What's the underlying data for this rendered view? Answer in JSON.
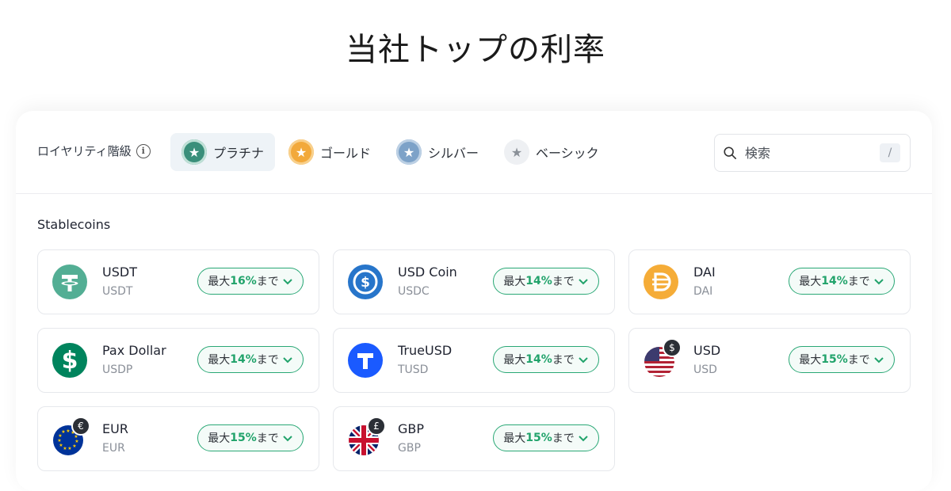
{
  "page": {
    "title": "当社トップの利率"
  },
  "filters": {
    "loyalty_label": "ロイヤリティ階級",
    "tiers": [
      {
        "label": "プラチナ",
        "color": "#3a8f7a",
        "active": true
      },
      {
        "label": "ゴールド",
        "color": "#f2a93b",
        "active": false
      },
      {
        "label": "シルバー",
        "color": "#7da2c8",
        "active": false
      },
      {
        "label": "ベーシック",
        "color": "#9aa0a8",
        "active": false
      }
    ],
    "search_placeholder": "検索",
    "search_shortcut": "/"
  },
  "section": {
    "title": "Stablecoins"
  },
  "rate_prefix": "最大",
  "rate_suffix": "まで",
  "coins": [
    {
      "name": "USDT",
      "symbol": "USDT",
      "rate": "16%",
      "icon": "tether-icon",
      "color": "#53ae94"
    },
    {
      "name": "USD Coin",
      "symbol": "USDC",
      "rate": "14%",
      "icon": "usdc-icon",
      "color": "#2775ca"
    },
    {
      "name": "DAI",
      "symbol": "DAI",
      "rate": "14%",
      "icon": "dai-icon",
      "color": "#f5ac37"
    },
    {
      "name": "Pax Dollar",
      "symbol": "USDP",
      "rate": "14%",
      "icon": "pax-dollar-icon",
      "color": "#00845d"
    },
    {
      "name": "TrueUSD",
      "symbol": "TUSD",
      "rate": "14%",
      "icon": "trueusd-icon",
      "color": "#1a5aff"
    },
    {
      "name": "USD",
      "symbol": "USD",
      "rate": "15%",
      "icon": "us-flag-icon",
      "color": "#b22234"
    },
    {
      "name": "EUR",
      "symbol": "EUR",
      "rate": "15%",
      "icon": "eu-flag-icon",
      "color": "#003399"
    },
    {
      "name": "GBP",
      "symbol": "GBP",
      "rate": "15%",
      "icon": "uk-flag-icon",
      "color": "#012169"
    }
  ],
  "colors": {
    "accent_green": "#21a36b",
    "pill_border": "#2aa876"
  }
}
